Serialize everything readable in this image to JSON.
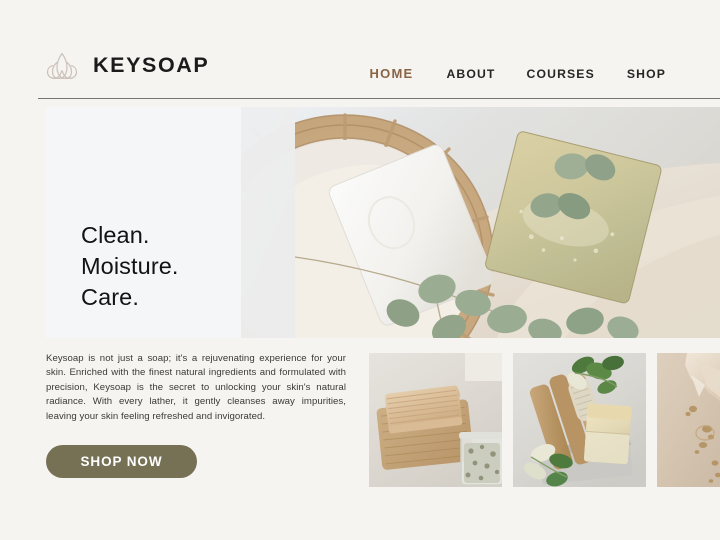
{
  "site": {
    "background_color": "#f6f4f1",
    "brand": {
      "name": "KEYSOAP",
      "logo_icon": "lotus-flower-icon",
      "logo_color": "#cdc2ba"
    }
  },
  "header": {
    "nav": [
      {
        "label": "HOME",
        "active": true,
        "color": "#8a6444"
      },
      {
        "label": "ABOUT",
        "active": false,
        "color": "#262626"
      },
      {
        "label": "COURSES",
        "active": false,
        "color": "#262626"
      },
      {
        "label": "SHOP",
        "active": false,
        "color": "#262626"
      }
    ]
  },
  "hero": {
    "headline_lines": [
      "Clean.",
      "Moisture.",
      "Care."
    ],
    "image_alt": "wicker-basket-with-white-soap-bar-green-soap-bar-and-eucalyptus-leaves-on-linen-cloth"
  },
  "intro": {
    "paragraph": "Keysoap is not just a soap; it's a rejuvenating experience for your skin. Enriched with the finest natural ingredients and formulated with precision, Keysoap is the secret to unlocking your skin's natural radiance. With every lather, it gently cleanses away impurities, leaving your skin feeling refreshed and invigorated.",
    "cta_label": "SHOP NOW",
    "cta_color": "#767055"
  },
  "gallery": {
    "items": [
      {
        "alt": "soap-bar-on-jute-knitted-mat-with-glass-jar-of-bath-salts"
      },
      {
        "alt": "wooden-brushes-and-soap-bars-with-green-leaves-in-metal-tray"
      },
      {
        "alt": "beige-crumpled-paper-with-soap-crumbs"
      }
    ]
  }
}
